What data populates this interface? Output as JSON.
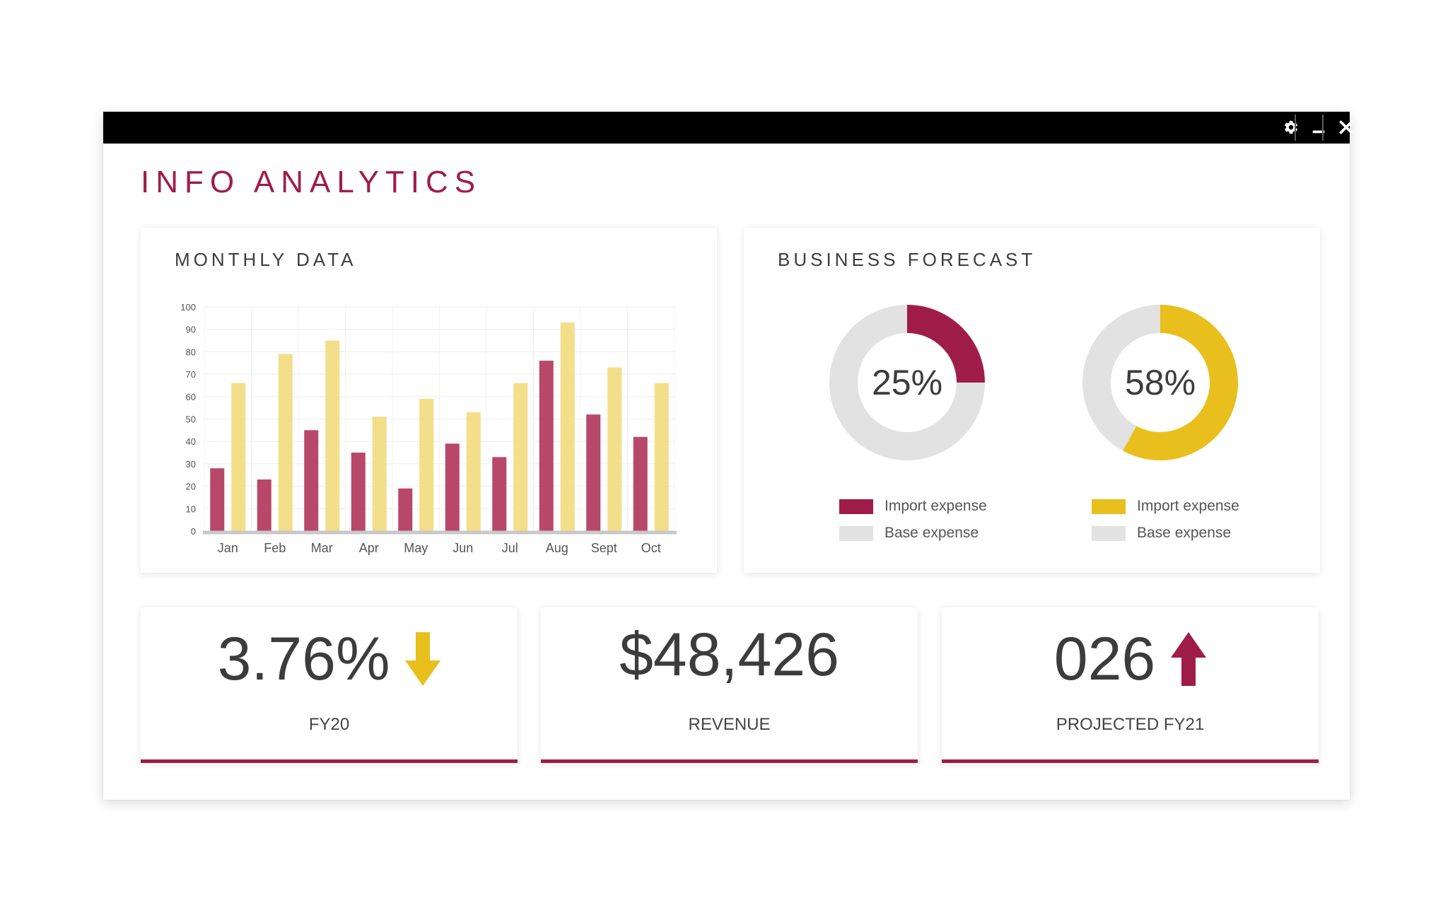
{
  "window": {
    "controls": {
      "settings_icon": "gear-icon",
      "minimize_icon": "minimize-icon",
      "close_icon": "close-icon"
    }
  },
  "app": {
    "title": "INFO ANALYTICS"
  },
  "colors": {
    "accent": "#a01c48",
    "bar_dark": "#b8486a",
    "bar_light": "#f3de8a",
    "yellow": "#e8bf1c",
    "base_gray": "#e2e2e2"
  },
  "monthly_data": {
    "title": "MONTHLY DATA",
    "chart_data": {
      "type": "bar",
      "categories": [
        "Jan",
        "Feb",
        "Mar",
        "Apr",
        "May",
        "Jun",
        "Jul",
        "Aug",
        "Sept",
        "Oct"
      ],
      "series": [
        {
          "values": [
            28,
            23,
            45,
            35,
            19,
            39,
            33,
            76,
            52,
            42
          ],
          "color": "#b8486a"
        },
        {
          "values": [
            66,
            79,
            85,
            51,
            59,
            53,
            66,
            93,
            73,
            66
          ],
          "color": "#f3de8a"
        }
      ],
      "yticks": [
        0,
        10,
        20,
        30,
        40,
        50,
        60,
        70,
        80,
        90,
        100
      ],
      "ylim": [
        0,
        100
      ],
      "grid": true
    }
  },
  "business_forecast": {
    "title": "BUSINESS FORECAST",
    "chart_data": [
      {
        "type": "pie",
        "center_label": "25%",
        "slices": [
          {
            "label": "Import expense",
            "value": 25,
            "color": "#a01c48"
          },
          {
            "label": "Base expense",
            "value": 75,
            "color": "#e2e2e2"
          }
        ]
      },
      {
        "type": "pie",
        "center_label": "58%",
        "slices": [
          {
            "label": "Import expense",
            "value": 58,
            "color": "#e8bf1c"
          },
          {
            "label": "Base expense",
            "value": 42,
            "color": "#e2e2e2"
          }
        ]
      }
    ]
  },
  "stats": [
    {
      "value": "3.76%",
      "label": "FY20",
      "trend_icon": "arrow-down-icon",
      "trend_color": "#e8bf1c"
    },
    {
      "value": "$48,426",
      "label": "REVENUE"
    },
    {
      "value": "026",
      "label": "PROJECTED FY21",
      "trend_icon": "arrow-up-icon",
      "trend_color": "#a01c48"
    }
  ]
}
